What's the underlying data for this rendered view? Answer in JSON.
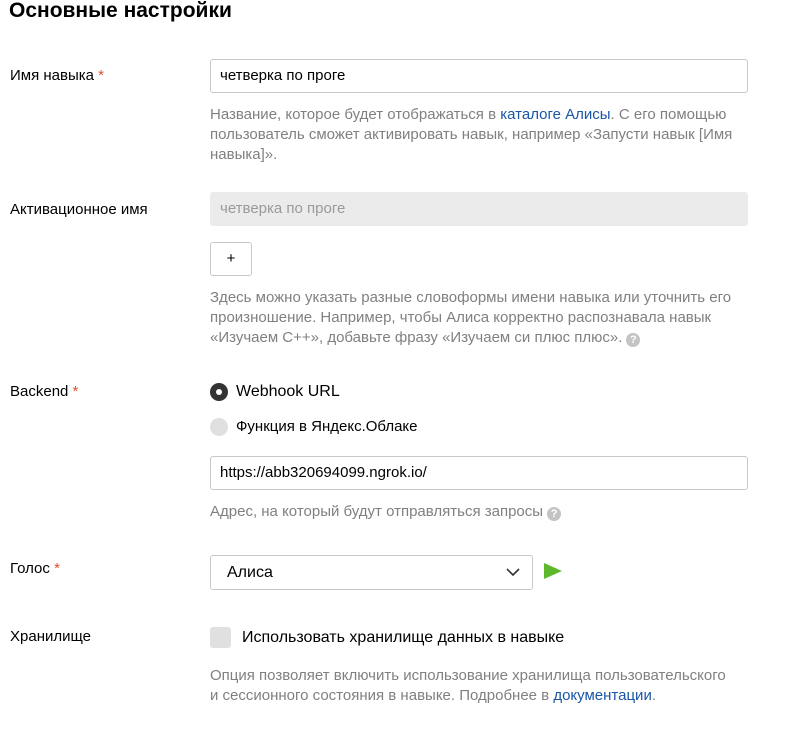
{
  "section": {
    "title": "Основные настройки"
  },
  "skill_name": {
    "label": "Имя навыка",
    "required_mark": "*",
    "value": "четверка по проге",
    "hint_before": "Название, которое будет отображаться в ",
    "hint_link": "каталоге Алисы",
    "hint_after": ". С его помощью пользователь сможет активировать навык, например «Запусти навык [Имя навыка]»."
  },
  "activation_name": {
    "label": "Активационное имя",
    "value": "четверка по проге",
    "add_button_label": "+",
    "hint": "Здесь можно указать разные словоформы имени навыка или уточнить его произношение. Например, чтобы Алиса корректно распознавала навык «Изучаем С++», добавьте фразу «Изучаем си плюс плюс».",
    "help_glyph": "?"
  },
  "backend": {
    "label": "Backend",
    "required_mark": "*",
    "options": [
      {
        "label": "Webhook URL",
        "selected": true
      },
      {
        "label": "Функция в Яндекс.Облаке",
        "selected": false
      }
    ],
    "url_value": "https://abb320694099.ngrok.io/",
    "hint": "Адрес, на который будут отправляться запросы",
    "help_glyph": "?"
  },
  "voice": {
    "label": "Голос",
    "required_mark": "*",
    "selected": "Алиса",
    "play_color": "#5db82c"
  },
  "storage": {
    "label": "Хранилище",
    "checkbox_label": "Использовать хранилище данных в навыке",
    "checked": false,
    "hint_before": "Опция позволяет включить использование хранилища пользовательского и сессионного состояния в навыке. Подробнее в ",
    "hint_link": "документации",
    "hint_after": "."
  },
  "colors": {
    "accent_link": "#1a56a6",
    "required": "#e0502d",
    "hint_text": "#808080"
  }
}
